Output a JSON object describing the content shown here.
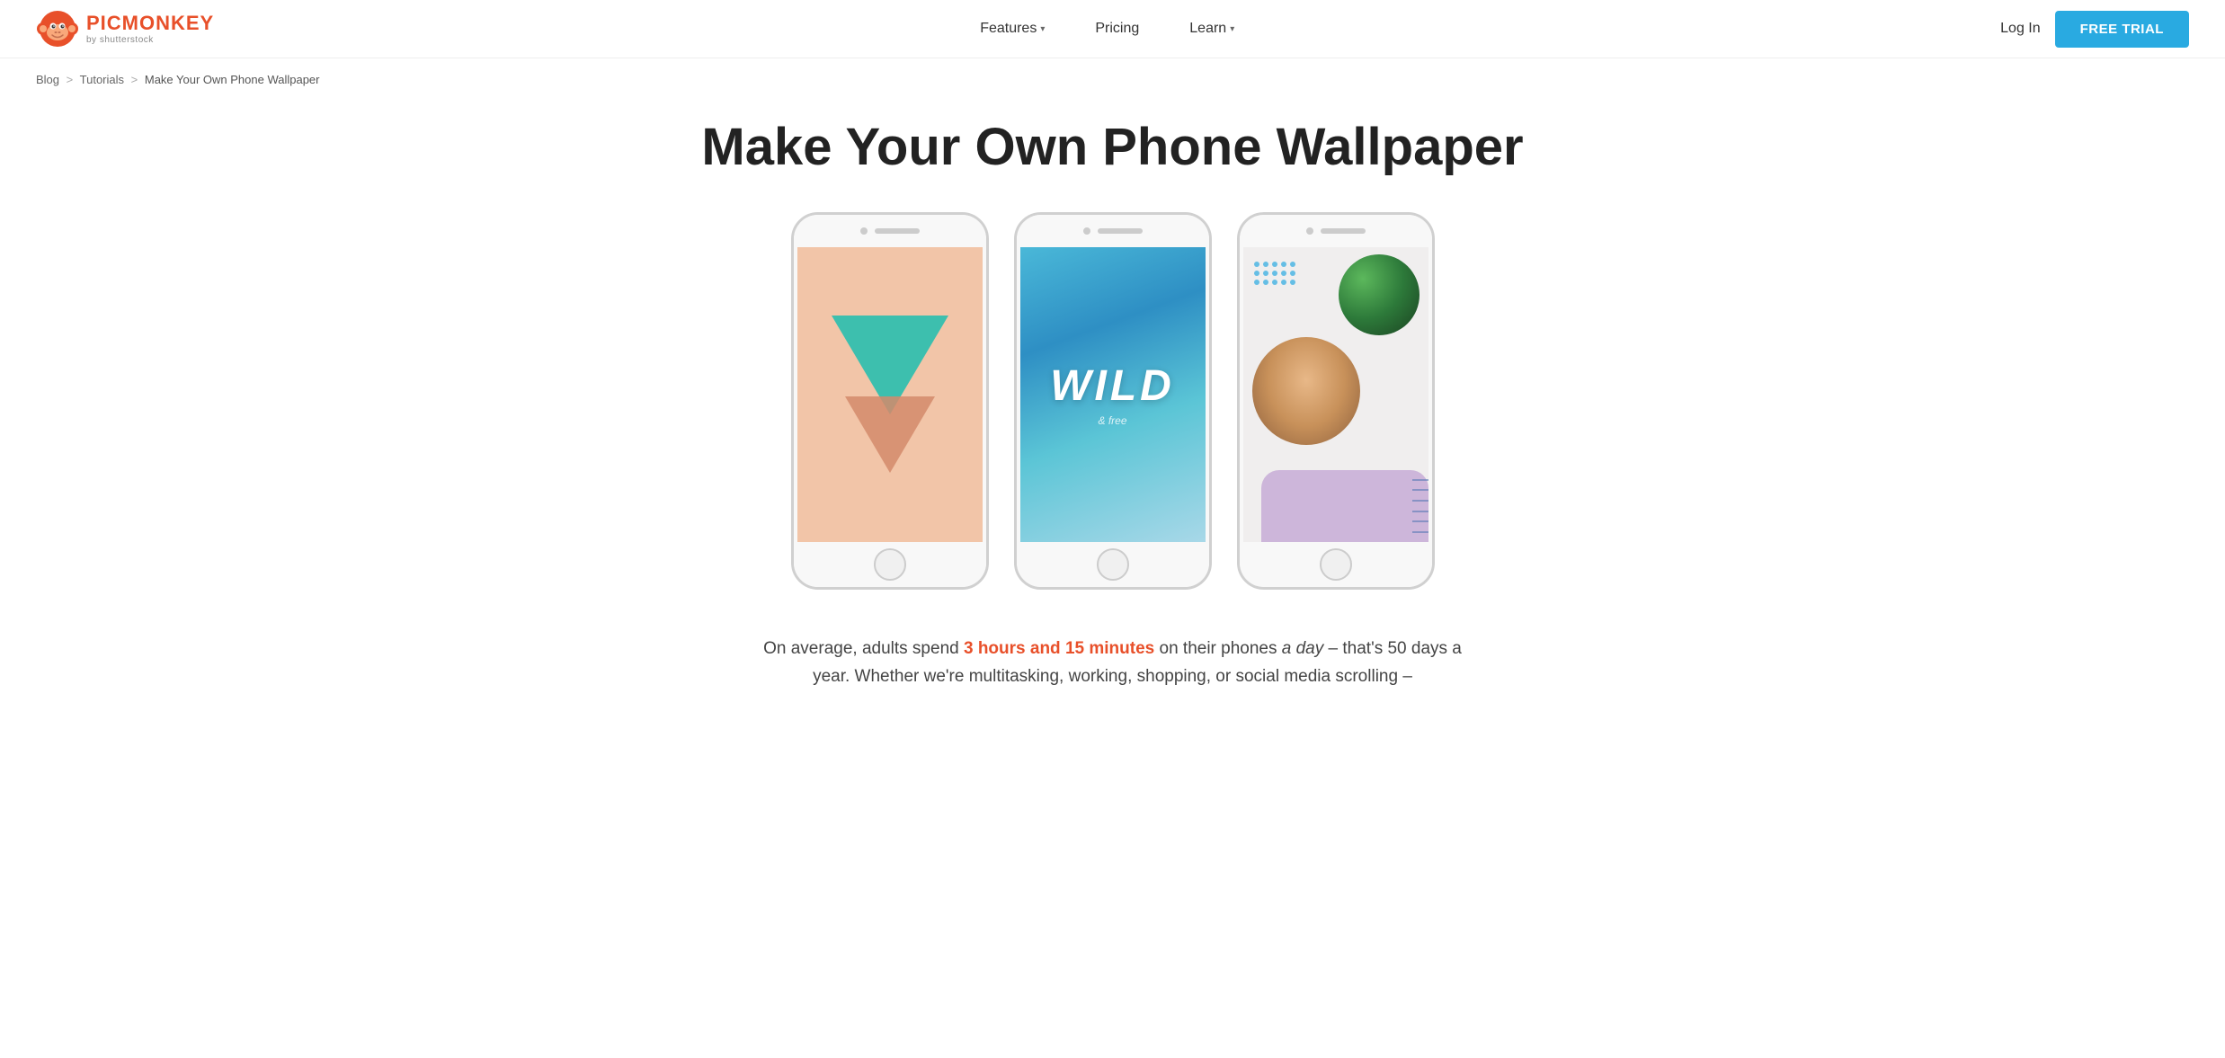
{
  "header": {
    "logo_main": "PICMONKEY",
    "logo_sub": "by shutterstock",
    "nav_items": [
      {
        "label": "Features",
        "has_dropdown": true
      },
      {
        "label": "Pricing",
        "has_dropdown": false
      },
      {
        "label": "Learn",
        "has_dropdown": true
      }
    ],
    "login_label": "Log In",
    "free_trial_label": "FREE TRIAL"
  },
  "breadcrumb": {
    "blog": "Blog",
    "tutorials": "Tutorials",
    "current": "Make Your Own Phone Wallpaper",
    "sep1": ">",
    "sep2": ">"
  },
  "main": {
    "page_title": "Make Your Own Phone Wallpaper",
    "phone1": {
      "label": "salmon triangle wallpaper"
    },
    "phone2": {
      "wild_text": "WILD",
      "wild_sub": "& free",
      "label": "blue wild wallpaper"
    },
    "phone3": {
      "label": "collage wallpaper"
    },
    "description_prefix": "On average, adults spend ",
    "description_highlight": "3 hours and 15 minutes",
    "description_mid": " on their phones ",
    "description_italic": "a day",
    "description_suffix": " – that's 50 days a year. Whether we're multitasking, working, shopping, or social media scrolling –"
  }
}
